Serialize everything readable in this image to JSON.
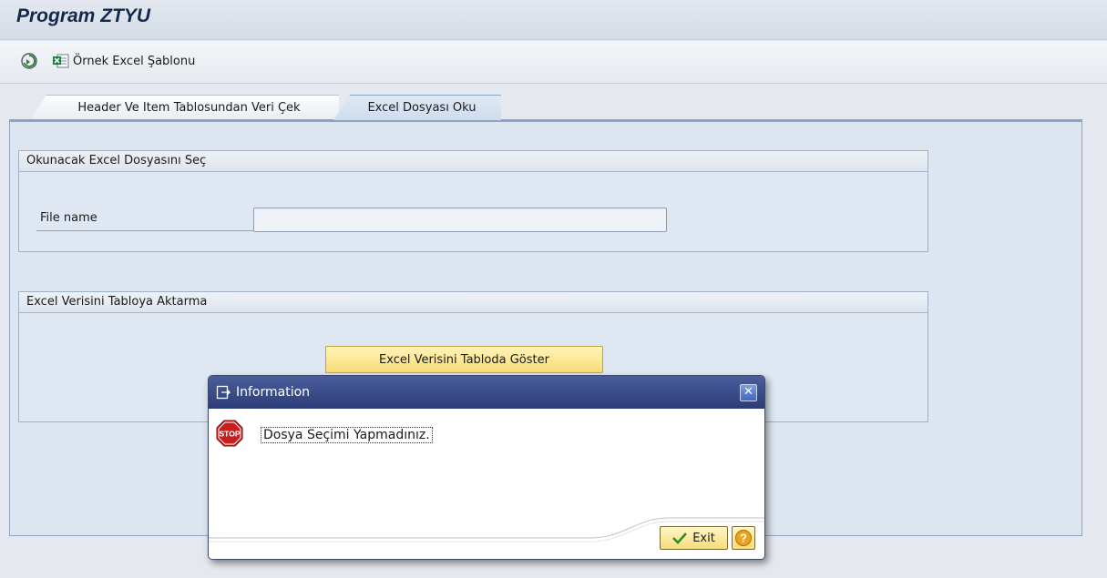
{
  "window": {
    "title": "Program ZTYU"
  },
  "toolbar": {
    "execute_icon": "execute-icon",
    "template_icon": "excel-template-icon",
    "template_label": "Örnek Excel Şablonu"
  },
  "tabs": [
    {
      "label": "Header Ve Item Tablosundan Veri Çek",
      "active": false
    },
    {
      "label": "Excel Dosyası Oku",
      "active": true
    }
  ],
  "groups": {
    "file_select": {
      "title": "Okunacak Excel Dosyasını Seç",
      "file_label": "File name",
      "file_value": ""
    },
    "transfer": {
      "title": "Excel Verisini Tabloya Aktarma",
      "button_label": "Excel Verisini Tabloda Göster"
    }
  },
  "dialog": {
    "title": "Information",
    "message": "Dosya Seçimi Yapmadınız.",
    "icon": "stop-icon",
    "exit_label": "Exit",
    "close_glyph": "✕"
  },
  "colors": {
    "title_text": "#13284a",
    "dialog_title_bg": "#2c3c78",
    "button_yellow": "#f8dd74",
    "stop_red": "#c81e1e"
  }
}
